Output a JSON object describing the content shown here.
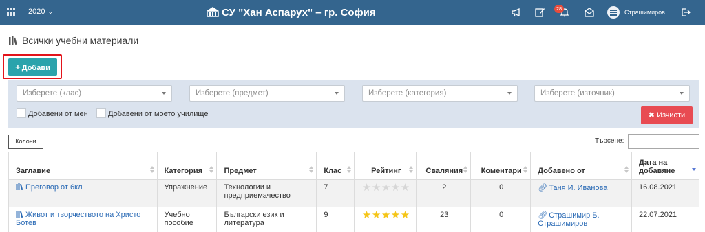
{
  "header": {
    "year": "2020",
    "school_title": "СУ \"Хан Аспарух\" – гр. София",
    "notification_count": "28",
    "username": "Страшимиров"
  },
  "page": {
    "title": "Всички учебни материали",
    "add_label": "Добави"
  },
  "filters": {
    "class_placeholder": "Изберете (клас)",
    "subject_placeholder": "Изберете (предмет)",
    "category_placeholder": "Изберете (категория)",
    "source_placeholder": "Изберете (източник)",
    "added_by_me": "Добавени от мен",
    "added_by_school": "Добавени от моето училище",
    "clear_label": "Изчисти"
  },
  "table_controls": {
    "columns_label": "Колони",
    "search_label": "Търсене:"
  },
  "table": {
    "headers": {
      "title": "Заглавие",
      "category": "Категория",
      "subject": "Предмет",
      "class": "Клас",
      "rating": "Рейтинг",
      "downloads": "Сваляния",
      "comments": "Коментари",
      "added_by": "Добавено от",
      "date_added": "Дата на добавяне"
    },
    "rows": [
      {
        "title": "Преговор от 6кл",
        "category": "Упражнение",
        "subject": "Технологии и предприемачество",
        "class": "7",
        "rating": 0,
        "downloads": "2",
        "comments": "0",
        "added_by": "Таня И. Иванова",
        "date": "16.08.2021"
      },
      {
        "title": "Живот и творчеството на Христо Ботев",
        "category": "Учебно пособие",
        "subject": "Български език и литература",
        "class": "9",
        "rating": 5,
        "downloads": "23",
        "comments": "0",
        "added_by": "Страшимир Б. Страшимиров",
        "date": "22.07.2021"
      }
    ]
  },
  "colors": {
    "topbar": "#34658e",
    "add_button": "#2aa3ac",
    "clear_button": "#e84b52",
    "highlight": "#e3141b",
    "star": "#f5c518"
  }
}
